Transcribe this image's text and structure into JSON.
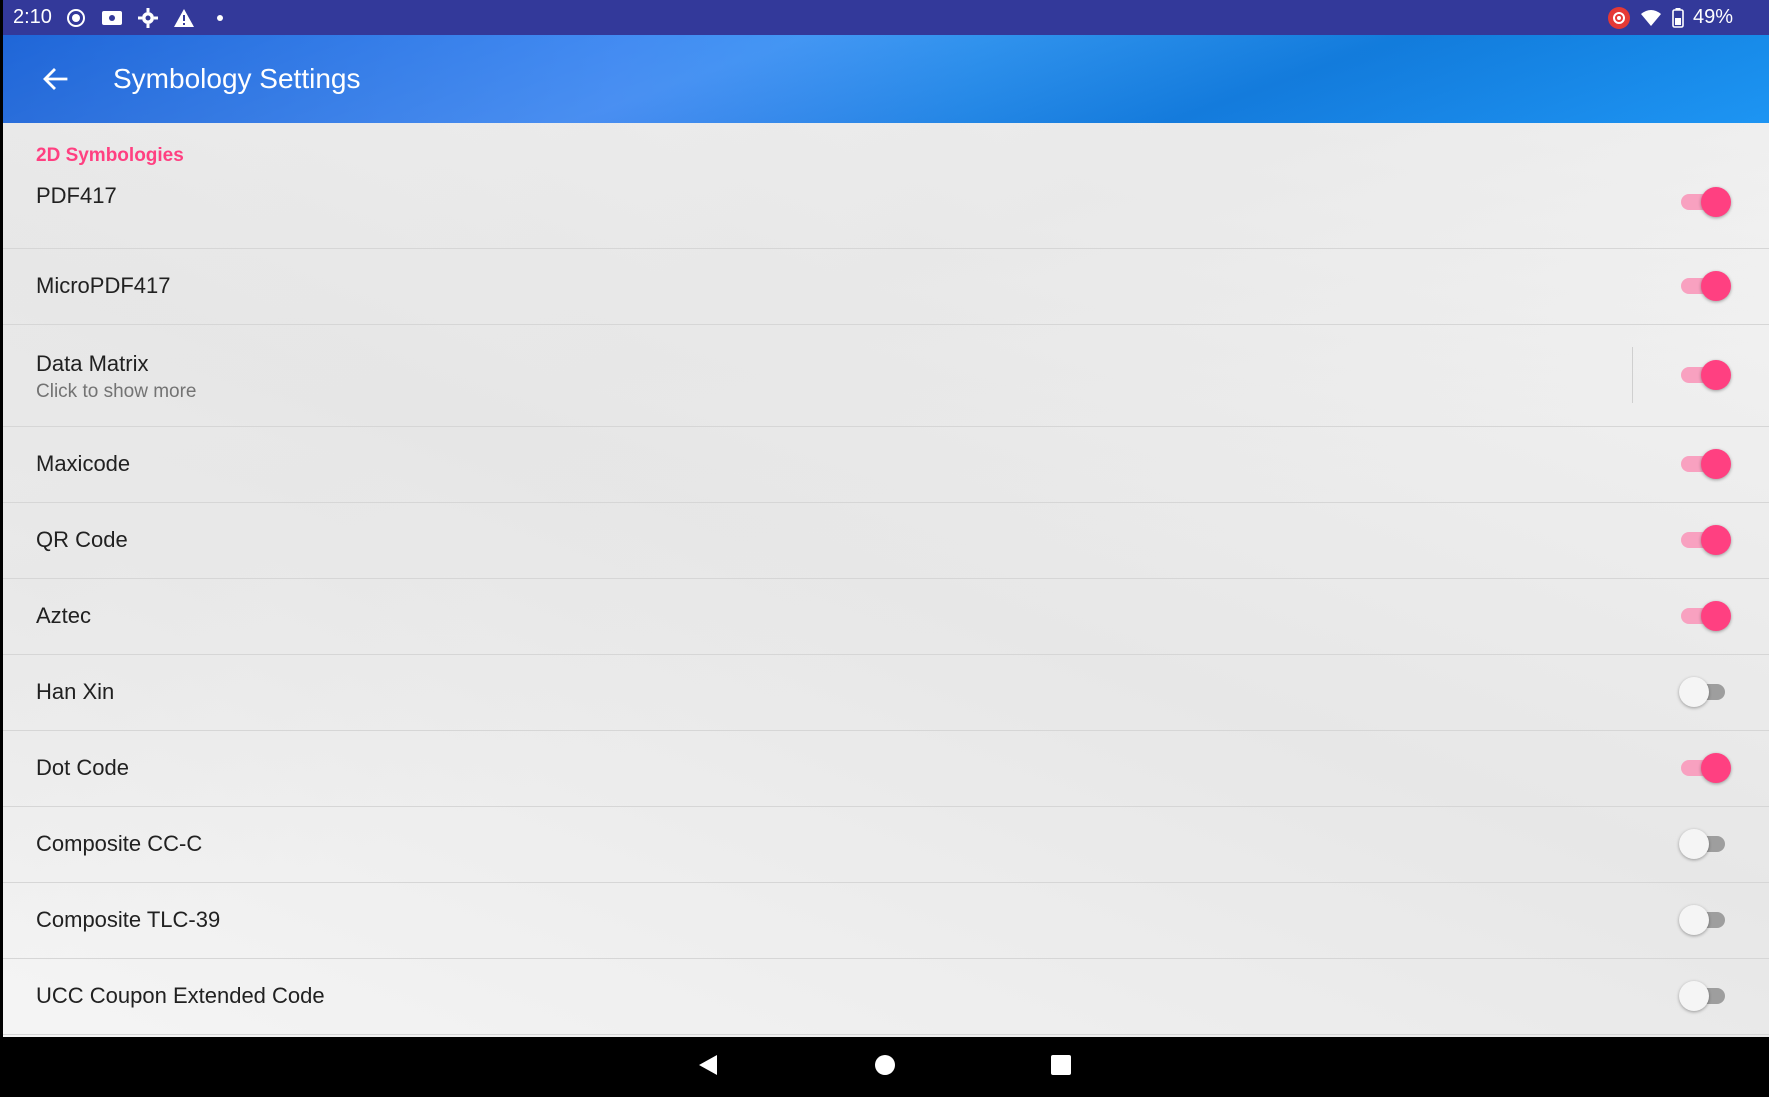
{
  "status_bar": {
    "time": "2:10",
    "battery_percent": "49%",
    "left_icons": [
      "screen-record-icon",
      "cast-icon",
      "settings-gear-icon",
      "warning-icon",
      "dot-icon"
    ],
    "right_icons": [
      "record-indicator-icon",
      "wifi-icon",
      "battery-icon"
    ]
  },
  "app_bar": {
    "title": "Symbology Settings",
    "back_icon": "arrow-back-icon"
  },
  "colors": {
    "accent": "#ff4081",
    "status_bar": "#33399a",
    "app_bar": "#1f7de8"
  },
  "section": {
    "header": "2D Symbologies"
  },
  "items": [
    {
      "label": "PDF417",
      "summary": "",
      "enabled": true
    },
    {
      "label": "MicroPDF417",
      "summary": "",
      "enabled": true
    },
    {
      "label": "Data Matrix",
      "summary": "Click to show more",
      "enabled": true
    },
    {
      "label": "Maxicode",
      "summary": "",
      "enabled": true
    },
    {
      "label": "QR Code",
      "summary": "",
      "enabled": true
    },
    {
      "label": "Aztec",
      "summary": "",
      "enabled": true
    },
    {
      "label": "Han Xin",
      "summary": "",
      "enabled": false
    },
    {
      "label": "Dot Code",
      "summary": "",
      "enabled": true
    },
    {
      "label": "Composite CC-C",
      "summary": "",
      "enabled": false
    },
    {
      "label": "Composite TLC-39",
      "summary": "",
      "enabled": false
    },
    {
      "label": "UCC Coupon Extended Code",
      "summary": "",
      "enabled": false
    }
  ],
  "nav_bar": {
    "buttons": [
      "back-triangle-icon",
      "home-circle-icon",
      "recents-square-icon"
    ]
  }
}
